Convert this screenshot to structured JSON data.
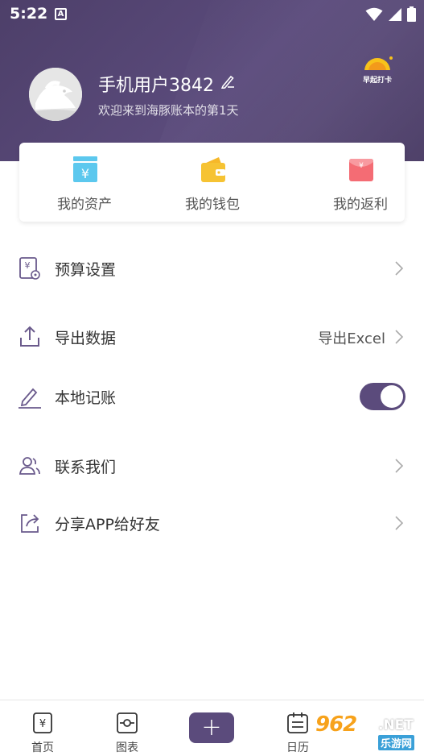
{
  "status_bar": {
    "time": "5:22",
    "notif_glyph": "A"
  },
  "profile": {
    "username": "手机用户3842",
    "welcome": "欢迎来到海豚账本的第1天",
    "checkin_label": "早起打卡"
  },
  "quick_actions": [
    {
      "label": "我的资产",
      "icon": "assets-icon",
      "color": "#5cc8ee"
    },
    {
      "label": "我的钱包",
      "icon": "wallet-icon",
      "color": "#f6c333"
    },
    {
      "label": "我的返利",
      "icon": "rebate-icon",
      "color": "#f46c74"
    }
  ],
  "menu": {
    "budget": {
      "label": "预算设置"
    },
    "export": {
      "label": "导出数据",
      "value": "导出Excel"
    },
    "local": {
      "label": "本地记账",
      "enabled": true
    },
    "contact": {
      "label": "联系我们"
    },
    "share": {
      "label": "分享APP给好友"
    }
  },
  "bottom_nav": {
    "home": "首页",
    "charts": "图表",
    "add": "+",
    "calendar": "日历"
  },
  "watermark": {
    "brand": "962",
    "net": ".NET",
    "sub": "乐游网"
  },
  "colors": {
    "primary": "#5b4b7c",
    "header": "#4d3f69",
    "menu_icon": "#6a5a8c"
  }
}
